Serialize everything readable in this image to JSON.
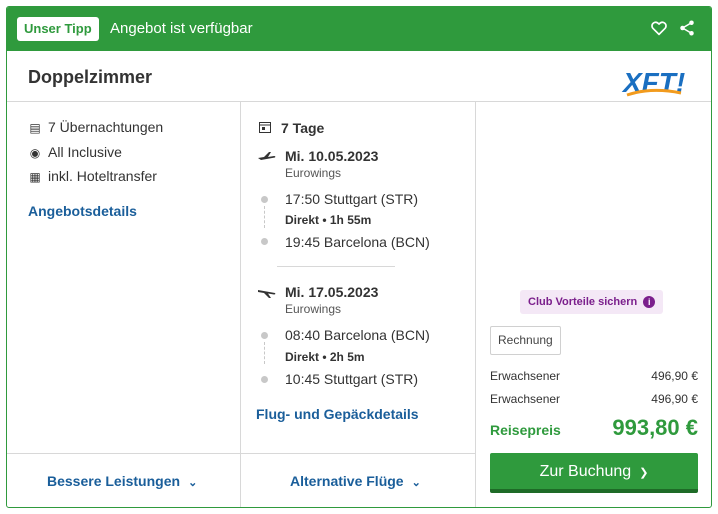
{
  "header": {
    "badge": "Unser Tipp",
    "offer_status": "Angebot ist verfügbar",
    "icons": [
      "heart-icon",
      "share-icon"
    ]
  },
  "room": {
    "title": "Doppelzimmer",
    "logo_text": "XFT!"
  },
  "features": {
    "nights": "7 Übernachtungen",
    "board": "All Inclusive",
    "transfer": "inkl. Hoteltransfer",
    "details_link": "Angebotsdetails"
  },
  "flights": {
    "duration": "7 Tage",
    "outbound": {
      "date": "Mi. 10.05.2023",
      "airline": "Eurowings",
      "dep": "17:50 Stuttgart (STR)",
      "info": "Direkt • 1h 55m",
      "arr": "19:45 Barcelona (BCN)"
    },
    "return": {
      "date": "Mi. 17.05.2023",
      "airline": "Eurowings",
      "dep": "08:40 Barcelona (BCN)",
      "info": "Direkt • 2h 5m",
      "arr": "10:45 Stuttgart (STR)"
    },
    "details_link": "Flug- und Gepäckdetails"
  },
  "pricing": {
    "club": "Club Vorteile sichern",
    "invoice": "Rechnung",
    "rows": [
      {
        "label": "Erwachsener",
        "value": "496,90 €"
      },
      {
        "label": "Erwachsener",
        "value": "496,90 €"
      }
    ],
    "total_label": "Reisepreis",
    "total_value": "993,80 €",
    "book_button": "Zur Buchung"
  },
  "footer": {
    "better_services": "Bessere Leistungen",
    "alt_flights": "Alternative Flüge"
  },
  "colors": {
    "brand_green": "#2f9a3d",
    "link_blue": "#1a5e9a",
    "club_purple": "#7b1f8c"
  }
}
